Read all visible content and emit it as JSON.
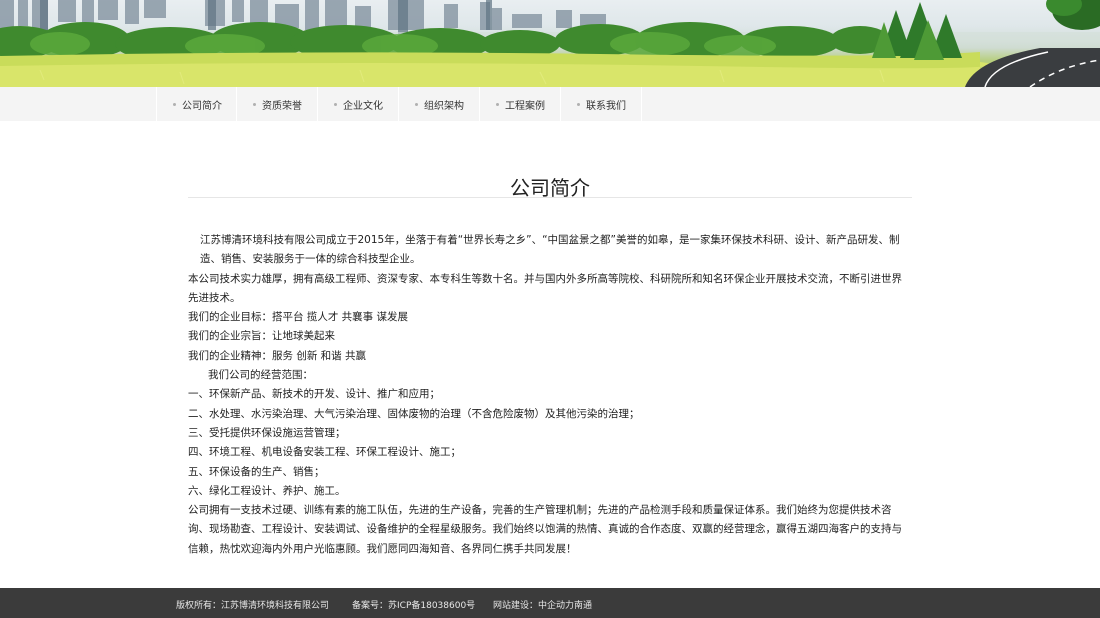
{
  "nav": {
    "items": [
      {
        "label": "公司简介"
      },
      {
        "label": "资质荣誉"
      },
      {
        "label": "企业文化"
      },
      {
        "label": "组织架构"
      },
      {
        "label": "工程案例"
      },
      {
        "label": "联系我们"
      }
    ]
  },
  "main": {
    "title": "公司简介",
    "paragraphs": [
      "江苏博清环境科技有限公司成立于2015年，坐落于有着“世界长寿之乡”、“中国盆景之都”美誉的如皋，是一家集环保技术科研、设计、新产品研发、制造、销售、安装服务于一体的综合科技型企业。",
      "本公司技术实力雄厚，拥有高级工程师、资深专家、本专科生等数十名。并与国内外多所高等院校、科研院所和知名环保企业开展技术交流，不断引进世界先进技术。",
      "我们的企业目标：搭平台  揽人才  共襄事  谋发展",
      "我们的企业宗旨：让地球美起来",
      "我们的企业精神：服务  创新  和谐  共赢",
      "我们公司的经营范围：",
      "一、环保新产品、新技术的开发、设计、推广和应用；",
      "二、水处理、水污染治理、大气污染治理、固体废物的治理（不含危险废物）及其他污染的治理；",
      "三、受托提供环保设施运营管理；",
      "四、环境工程、机电设备安装工程、环保工程设计、施工；",
      "五、环保设备的生产、销售；",
      "六、绿化工程设计、养护、施工。",
      "公司拥有一支技术过硬、训练有素的施工队伍，先进的生产设备，完善的生产管理机制；先进的产品检测手段和质量保证体系。我们始终为您提供技术咨询、现场勘查、工程设计、安装调试、设备维护的全程星级服务。我们始终以饱满的热情、真诚的合作态度、双赢的经营理念，赢得五湖四海客户的支持与信赖，热忱欢迎海内外用户光临惠顾。我们愿同四海知音、各界同仁携手共同发展！"
    ]
  },
  "footer": {
    "copyright": "版权所有：江苏博清环境科技有限公司",
    "icp": "备案号：苏ICP备18038600号",
    "builder": "网站建设：中企动力南通"
  },
  "colors": {
    "nav_bg": "#f4f4f4",
    "footer_bg": "#3b3b3b",
    "grass": "#c9dc5a"
  }
}
